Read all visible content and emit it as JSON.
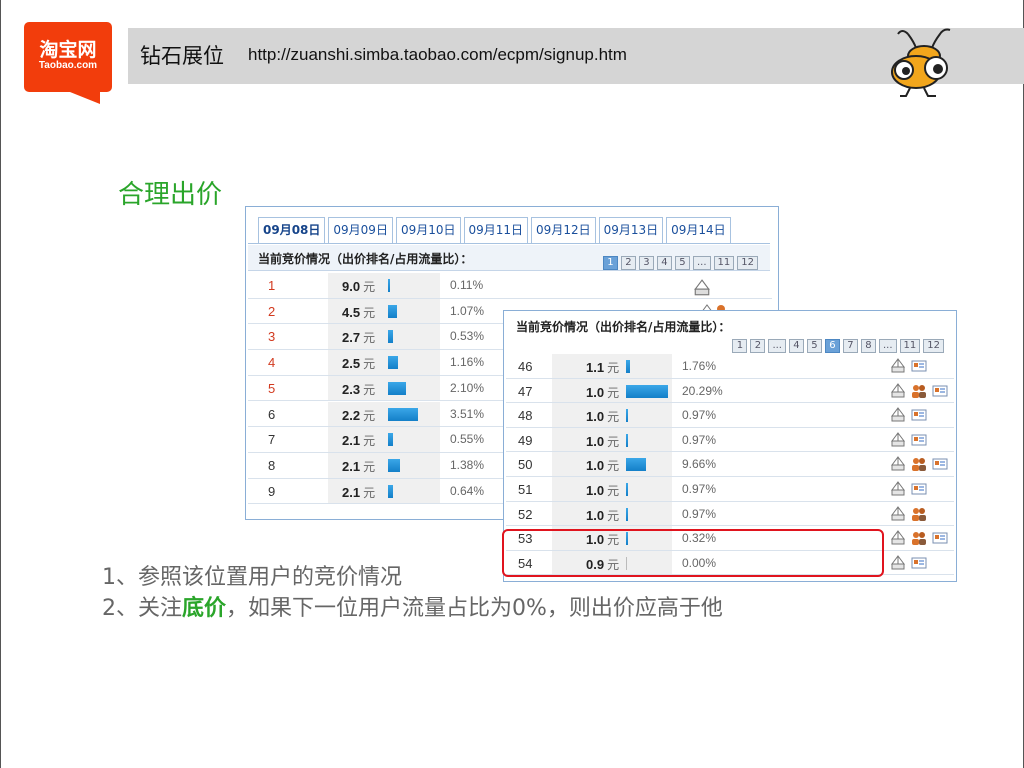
{
  "logo": {
    "cn": "淘宝网",
    "en": "Taobao.com",
    "color": "#f23d0c"
  },
  "header": {
    "title": "钻石展位",
    "url": "http://zuanshi.simba.taobao.com/ecpm/signup.htm"
  },
  "section_title": "合理出价",
  "panel1": {
    "tabs": [
      "09月08日",
      "09月09日",
      "09月10日",
      "09月11日",
      "09月12日",
      "09月13日",
      "09月14日"
    ],
    "active_tab": 0,
    "bid_title": "当前竞价情况（出价排名/占用流量比）：",
    "pages": [
      "1",
      "2",
      "3",
      "4",
      "5",
      "...",
      "11",
      "12"
    ],
    "active_page": 0,
    "rows": [
      {
        "rank": "1",
        "price": "9.0",
        "unit": "元",
        "share": "0.11%",
        "share_value": 0.11
      },
      {
        "rank": "2",
        "price": "4.5",
        "unit": "元",
        "share": "1.07%",
        "share_value": 1.07
      },
      {
        "rank": "3",
        "price": "2.7",
        "unit": "元",
        "share": "0.53%",
        "share_value": 0.53
      },
      {
        "rank": "4",
        "price": "2.5",
        "unit": "元",
        "share": "1.16%",
        "share_value": 1.16
      },
      {
        "rank": "5",
        "price": "2.3",
        "unit": "元",
        "share": "2.10%",
        "share_value": 2.1
      },
      {
        "rank": "6",
        "price": "2.2",
        "unit": "元",
        "share": "3.51%",
        "share_value": 3.51
      },
      {
        "rank": "7",
        "price": "2.1",
        "unit": "元",
        "share": "0.55%",
        "share_value": 0.55
      },
      {
        "rank": "8",
        "price": "2.1",
        "unit": "元",
        "share": "1.38%",
        "share_value": 1.38
      },
      {
        "rank": "9",
        "price": "2.1",
        "unit": "元",
        "share": "0.64%",
        "share_value": 0.64
      }
    ]
  },
  "panel2": {
    "bid_title": "当前竞价情况（出价排名/占用流量比）：",
    "pages": [
      "1",
      "2",
      "...",
      "4",
      "5",
      "6",
      "7",
      "8",
      "...",
      "11",
      "12"
    ],
    "active_page": 5,
    "rows": [
      {
        "rank": "46",
        "price": "1.1",
        "unit": "元",
        "share": "1.76%",
        "share_value": 1.76,
        "icons": [
          "tent-icon",
          "card-icon"
        ]
      },
      {
        "rank": "47",
        "price": "1.0",
        "unit": "元",
        "share": "20.29%",
        "share_value": 20.29,
        "icons": [
          "tent-icon",
          "users-icon",
          "card-icon"
        ]
      },
      {
        "rank": "48",
        "price": "1.0",
        "unit": "元",
        "share": "0.97%",
        "share_value": 0.97,
        "icons": [
          "tent-icon",
          "card-icon"
        ]
      },
      {
        "rank": "49",
        "price": "1.0",
        "unit": "元",
        "share": "0.97%",
        "share_value": 0.97,
        "icons": [
          "tent-icon",
          "card-icon"
        ]
      },
      {
        "rank": "50",
        "price": "1.0",
        "unit": "元",
        "share": "9.66%",
        "share_value": 9.66,
        "icons": [
          "tent-icon",
          "users-icon",
          "card-icon"
        ]
      },
      {
        "rank": "51",
        "price": "1.0",
        "unit": "元",
        "share": "0.97%",
        "share_value": 0.97,
        "icons": [
          "tent-icon",
          "card-icon"
        ]
      },
      {
        "rank": "52",
        "price": "1.0",
        "unit": "元",
        "share": "0.97%",
        "share_value": 0.97,
        "icons": [
          "tent-icon",
          "users-icon"
        ]
      },
      {
        "rank": "53",
        "price": "1.0",
        "unit": "元",
        "share": "0.32%",
        "share_value": 0.32,
        "icons": [
          "tent-icon",
          "users-icon",
          "card-icon"
        ]
      },
      {
        "rank": "54",
        "price": "0.9",
        "unit": "元",
        "share": "0.00%",
        "share_value": 0.0,
        "icons": [
          "tent-icon",
          "card-icon"
        ]
      }
    ]
  },
  "notes": {
    "line1": "1、参照该位置用户的竞价情况",
    "line2_pre": "2、关注",
    "line2_em": "底价",
    "line2_post": "，如果下一位用户流量占比为0%，则出价应高于他"
  },
  "colors": {
    "accent_green": "#2aa52a",
    "highlight_red": "#e0141e",
    "bar_blue": "#1a8ad6",
    "rank_red": "#d23a1f"
  }
}
